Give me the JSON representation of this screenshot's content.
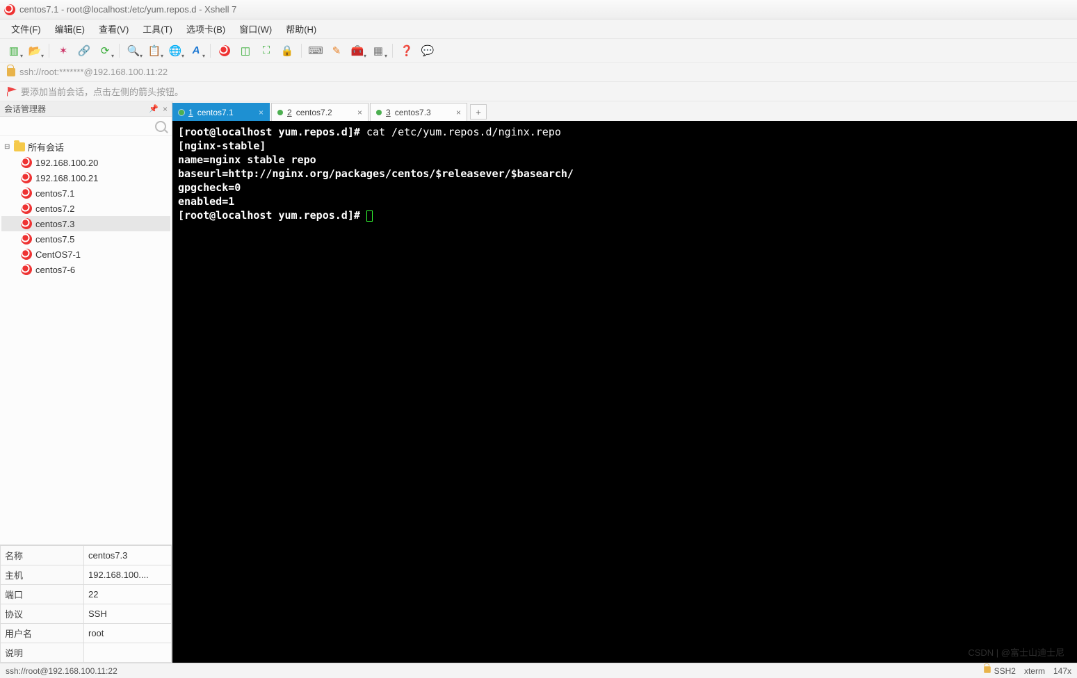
{
  "title": "centos7.1 - root@localhost:/etc/yum.repos.d - Xshell 7",
  "menu": {
    "items": [
      "文件(F)",
      "编辑(E)",
      "查看(V)",
      "工具(T)",
      "选项卡(B)",
      "窗口(W)",
      "帮助(H)"
    ]
  },
  "address": "ssh://root:*******@192.168.100.11:22",
  "hint": "要添加当前会话，点击左侧的箭头按钮。",
  "sidebar": {
    "title": "会话管理器",
    "root": "所有会话",
    "items": [
      "192.168.100.20",
      "192.168.100.21",
      "centos7.1",
      "centos7.2",
      "centos7.3",
      "centos7.5",
      "CentOS7-1",
      "centos7-6"
    ],
    "selected_index": 4
  },
  "props": {
    "rows": [
      {
        "k": "名称",
        "v": "centos7.3"
      },
      {
        "k": "主机",
        "v": "192.168.100...."
      },
      {
        "k": "端口",
        "v": "22"
      },
      {
        "k": "协议",
        "v": "SSH"
      },
      {
        "k": "用户名",
        "v": "root"
      },
      {
        "k": "说明",
        "v": ""
      }
    ]
  },
  "tabs": {
    "items": [
      {
        "num": "1",
        "label": "centos7.1",
        "active": true
      },
      {
        "num": "2",
        "label": "centos7.2",
        "active": false
      },
      {
        "num": "3",
        "label": "centos7.3",
        "active": false
      }
    ]
  },
  "terminal": {
    "lines": [
      {
        "prompt": "[root@localhost yum.repos.d]# ",
        "cmd": "cat /etc/yum.repos.d/nginx.repo"
      },
      {
        "text": "[nginx-stable]"
      },
      {
        "text": "name=nginx stable repo"
      },
      {
        "text": "baseurl=http://nginx.org/packages/centos/$releasever/$basearch/"
      },
      {
        "text": "gpgcheck=0"
      },
      {
        "text": "enabled=1"
      },
      {
        "prompt": "[root@localhost yum.repos.d]# ",
        "cursor": true
      }
    ]
  },
  "status": {
    "left": "ssh://root@192.168.100.11:22",
    "ssh": "SSH2",
    "term": "xterm",
    "size": "147x"
  },
  "watermark": "CSDN | @富士山迪士尼"
}
